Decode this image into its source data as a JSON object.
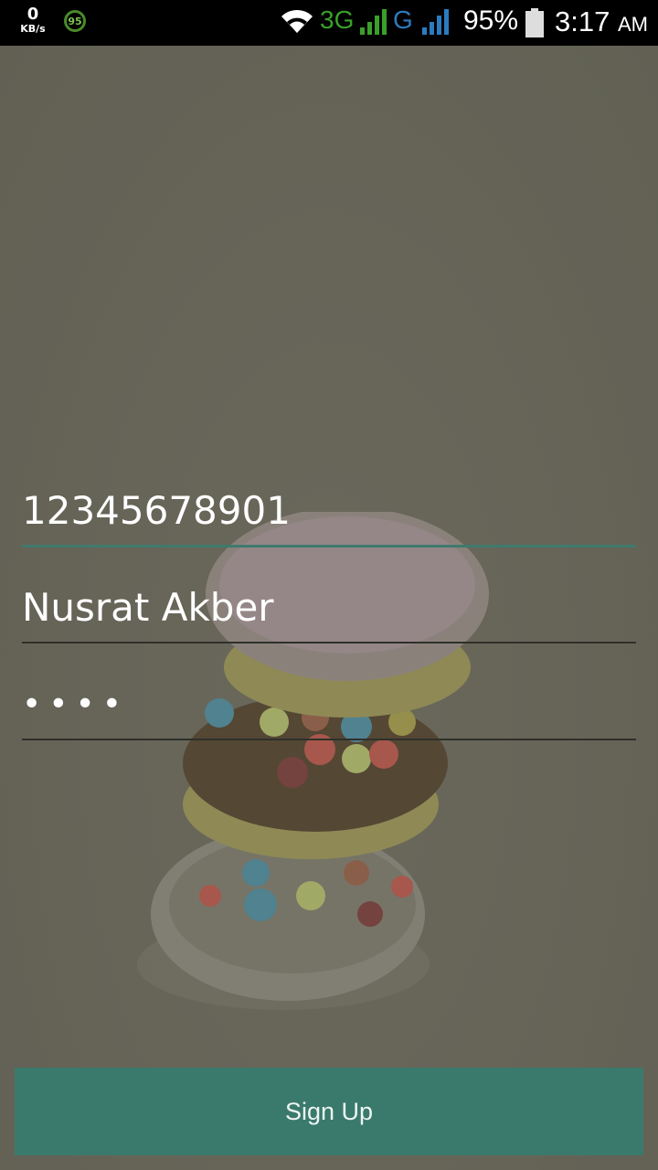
{
  "status_bar": {
    "net_speed": "0",
    "net_speed_unit": "KB/s",
    "badge": "95",
    "network_3g": "3G",
    "network_g": "G",
    "battery": "95%",
    "time": "3:17",
    "ampm": "AM"
  },
  "form": {
    "phone_value": "12345678901",
    "name_value": "Nusrat Akber",
    "password_value": "••••",
    "signup_label": "Sign Up"
  },
  "colors": {
    "accent": "#3a7a6c",
    "active_underline": "#3e7a6c",
    "status_bar": "#000000",
    "background": "#6b695c"
  }
}
